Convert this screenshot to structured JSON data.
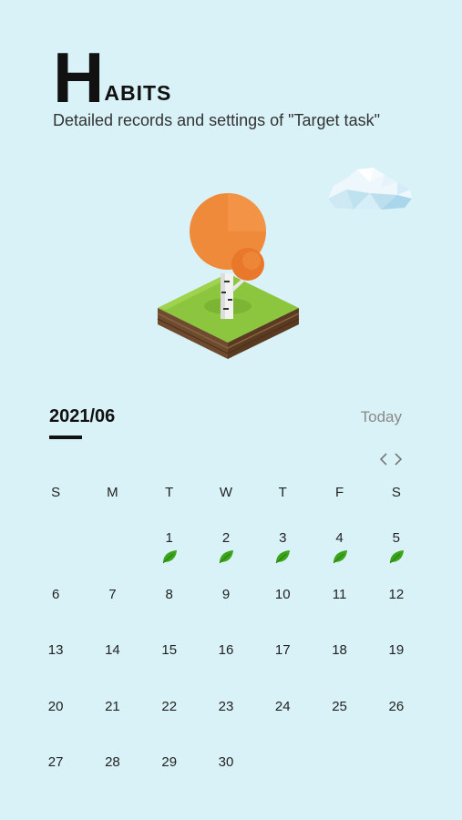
{
  "header": {
    "title_initial": "H",
    "title_rest": "ABITS",
    "subtitle": "Detailed records and settings of \"Target task\""
  },
  "calendar": {
    "month": "2021/06",
    "today_label": "Today",
    "weekdays": [
      "S",
      "M",
      "T",
      "W",
      "T",
      "F",
      "S"
    ],
    "weeks": [
      [
        "",
        "",
        "1",
        "2",
        "3",
        "4",
        "5"
      ],
      [
        "6",
        "7",
        "8",
        "9",
        "10",
        "11",
        "12"
      ],
      [
        "13",
        "14",
        "15",
        "16",
        "17",
        "18",
        "19"
      ],
      [
        "20",
        "21",
        "22",
        "23",
        "24",
        "25",
        "26"
      ],
      [
        "27",
        "28",
        "29",
        "30",
        "",
        "",
        ""
      ]
    ],
    "completed_days": [
      "1",
      "2",
      "3",
      "4",
      "5"
    ],
    "leaf_icon": "leaf-icon"
  },
  "colors": {
    "background": "#d9f2f7",
    "leaf": "#3aa51b",
    "tree_crown": "#ef8a3a",
    "grass": "#8cc63f"
  }
}
